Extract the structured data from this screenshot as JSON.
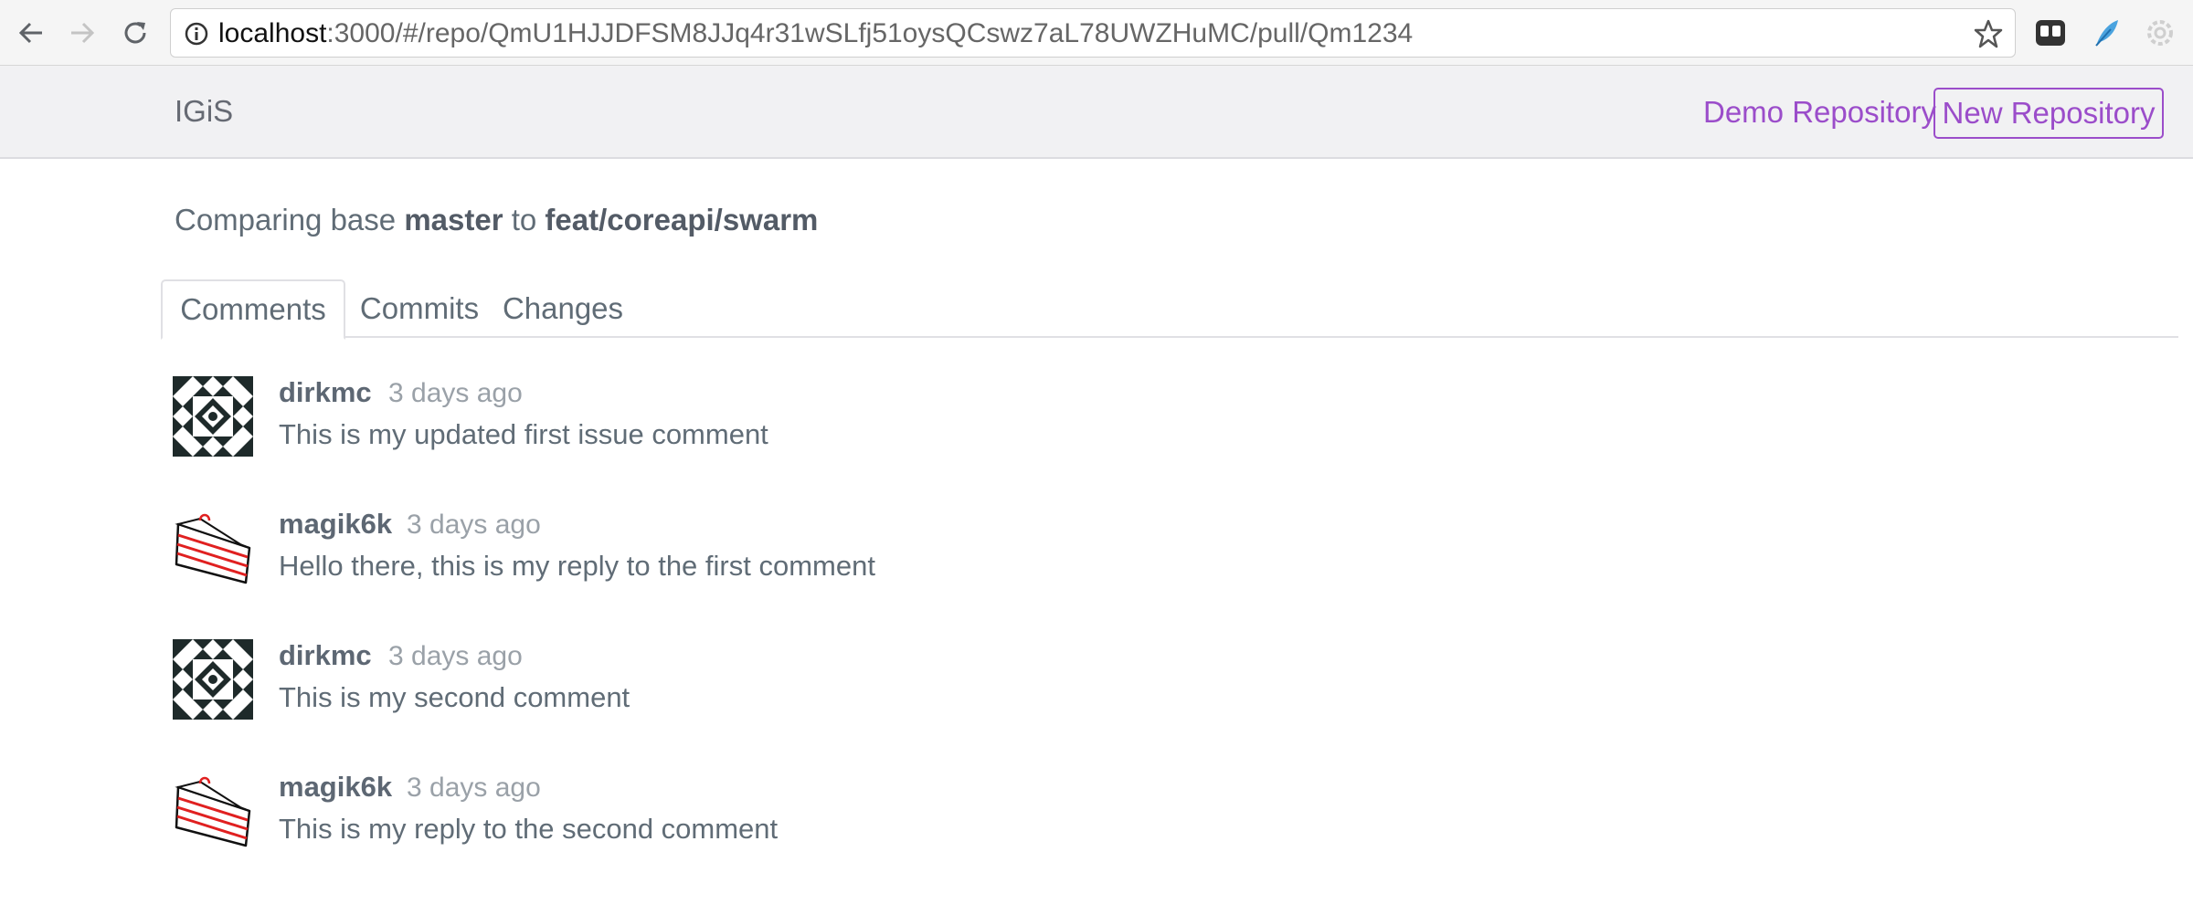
{
  "browser": {
    "url_host": "localhost",
    "url_rest": ":3000/#/repo/QmU1HJJDFSM8JJq4r31wSLfj51oysQCswz7aL78UWZHuMC/pull/Qm1234",
    "icons": [
      "back-arrow-icon",
      "forward-arrow-icon",
      "reload-icon",
      "info-icon",
      "star-icon",
      "ghostery-icon",
      "feather-icon",
      "settings-gear-icon"
    ]
  },
  "navbar": {
    "brand": "IGiS",
    "demo_link": "Demo Repository",
    "new_repo_button": "New Repository"
  },
  "compare": {
    "prefix": "Comparing base",
    "base": "master",
    "middle": "to",
    "head": "feat/coreapi/swarm"
  },
  "tabs": [
    "Comments",
    "Commits",
    "Changes"
  ],
  "active_tab": "Comments",
  "comments": [
    {
      "author": "dirkmc",
      "time": "3 days ago",
      "body": "This is my updated first issue comment",
      "avatar": "geometric-pattern-avatar"
    },
    {
      "author": "magik6k",
      "time": "3 days ago",
      "body": "Hello there, this is my reply to the first comment",
      "avatar": "cake-slice-avatar"
    },
    {
      "author": "dirkmc",
      "time": "3 days ago",
      "body": "This is my second comment",
      "avatar": "geometric-pattern-avatar"
    },
    {
      "author": "magik6k",
      "time": "3 days ago",
      "body": "This is my reply to the second comment",
      "avatar": "cake-slice-avatar"
    }
  ],
  "colors": {
    "accent": "#9b4dca",
    "text": "#606c76",
    "muted": "#9aa1a8",
    "navbar_bg": "#f1f1f3"
  }
}
